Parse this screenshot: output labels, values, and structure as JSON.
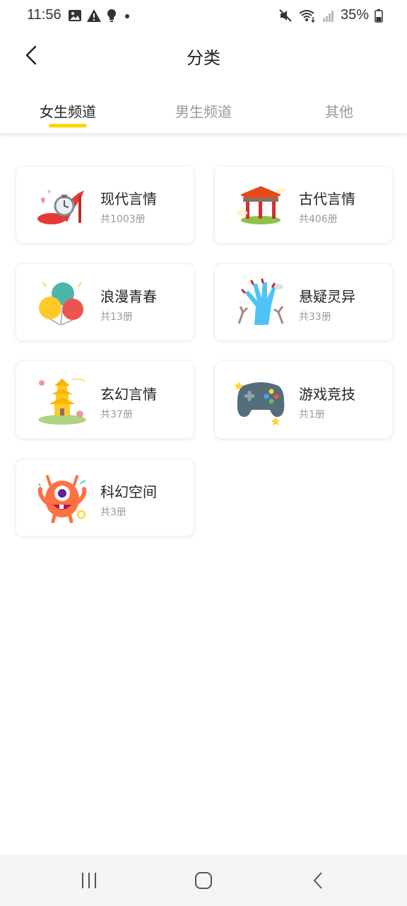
{
  "status_bar": {
    "time": "11:56",
    "battery_percent": "35%",
    "icons": [
      "image-icon",
      "alert-icon",
      "bulb-icon",
      "dot-icon",
      "mute-icon",
      "wifi-icon",
      "signal-icon",
      "battery-icon"
    ]
  },
  "header": {
    "title": "分类",
    "back_icon": "chevron-left-icon"
  },
  "tabs": [
    {
      "label": "女生频道",
      "active": true
    },
    {
      "label": "男生频道",
      "active": false
    },
    {
      "label": "其他",
      "active": false
    }
  ],
  "categories": [
    {
      "title": "现代言情",
      "count": "共1003册",
      "icon": "high-heel-watch-icon"
    },
    {
      "title": "古代言情",
      "count": "共406册",
      "icon": "pavilion-icon"
    },
    {
      "title": "浪漫青春",
      "count": "共13册",
      "icon": "balloons-icon"
    },
    {
      "title": "悬疑灵异",
      "count": "共33册",
      "icon": "zombie-hand-icon"
    },
    {
      "title": "玄幻言情",
      "count": "共37册",
      "icon": "pagoda-icon"
    },
    {
      "title": "游戏竞技",
      "count": "共1册",
      "icon": "gamepad-icon"
    },
    {
      "title": "科幻空间",
      "count": "共3册",
      "icon": "alien-monster-icon"
    }
  ],
  "navbar": {
    "icons": [
      "recent-apps-icon",
      "home-icon",
      "back-icon"
    ]
  },
  "colors": {
    "accent": "#FFD600",
    "tab_inactive": "#999999",
    "text_primary": "#222222",
    "nav_bg": "#f5f5f5"
  }
}
